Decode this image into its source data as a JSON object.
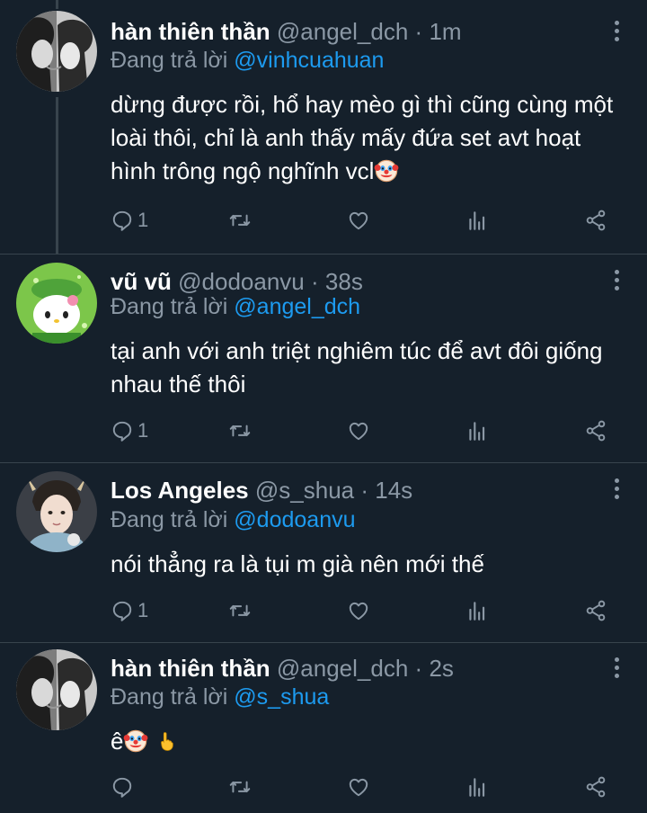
{
  "labels": {
    "replying_prefix": "Đang trả lời",
    "dot": "·"
  },
  "tweets": [
    {
      "name": "hàn thiên thần",
      "handle": "@angel_dch",
      "time": "1m",
      "reply_to": "@vinhcuahuan",
      "text": "dừng được rồi, hổ hay mèo gì thì cũng cùng một loài thôi, chỉ là anh thấy mấy đứa set avt hoạt hình trông ngộ nghĩnh vcl",
      "reply_count": "1",
      "emoji_after_text": "clown-face"
    },
    {
      "name": "vũ vũ",
      "handle": "@dodoanvu",
      "time": "38s",
      "reply_to": "@angel_dch",
      "text": "tại anh với anh triệt nghiêm túc để avt đôi giống nhau thế thôi",
      "reply_count": "1"
    },
    {
      "name": "Los Angeles",
      "handle": "@s_shua",
      "time": "14s",
      "reply_to": "@dodoanvu",
      "text": "nói thẳng ra là tụi m già nên mới thế",
      "reply_count": "1"
    },
    {
      "name": "hàn thiên thần",
      "handle": "@angel_dch",
      "time": "2s",
      "reply_to": "@s_shua",
      "text": "ê",
      "reply_count": "",
      "emoji_after_text": "clown-face, middle-finger"
    }
  ],
  "colors": {
    "background": "#15202b",
    "secondary_text": "#8b98a5",
    "mention": "#1d9bf0",
    "divider": "#38444d"
  },
  "icons": [
    "reply-icon",
    "retweet-icon",
    "like-icon",
    "analytics-icon",
    "share-icon",
    "more-icon"
  ]
}
